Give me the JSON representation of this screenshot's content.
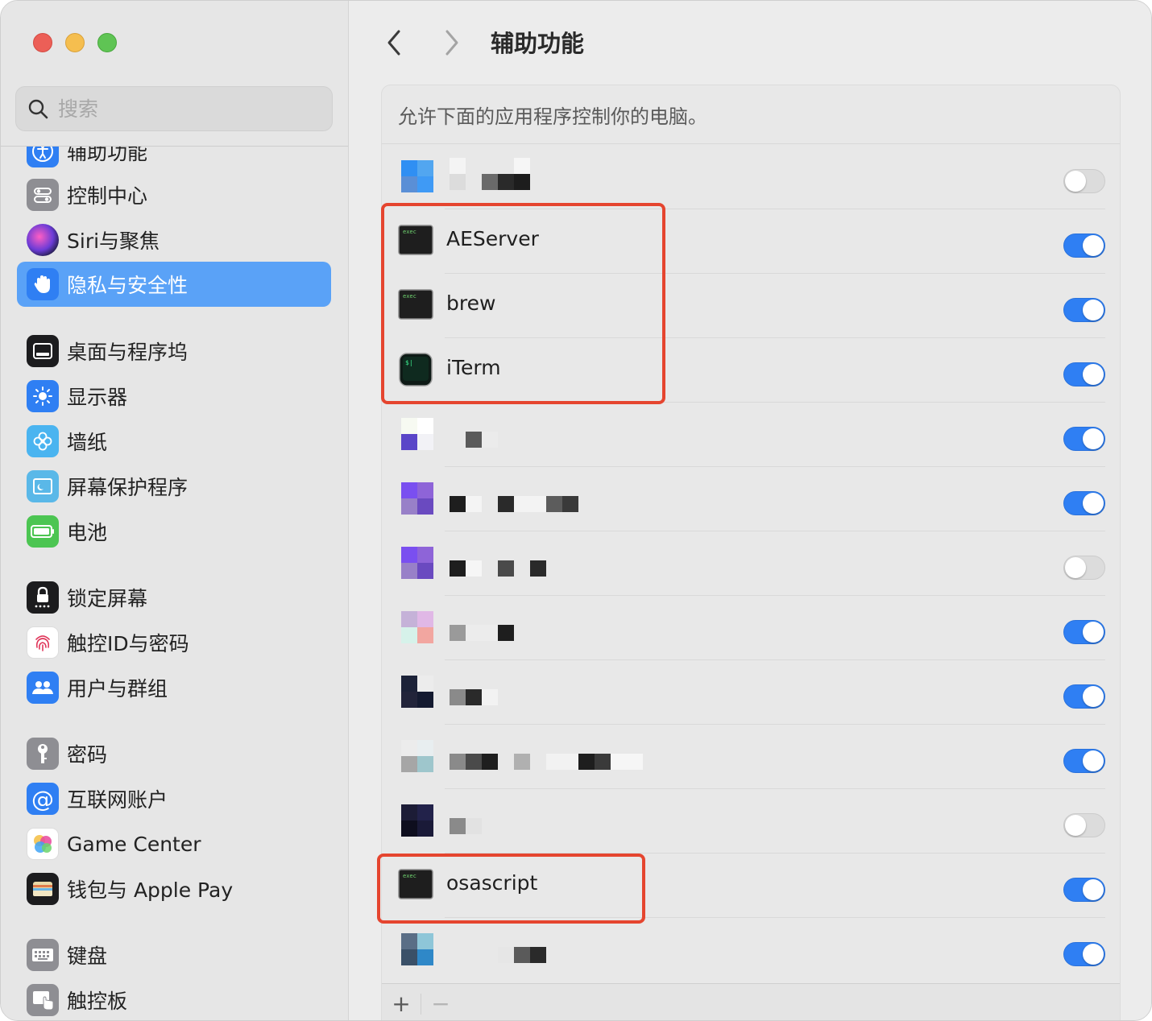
{
  "sidebar": {
    "search_placeholder": "搜索",
    "items": [
      {
        "label": "辅助功能",
        "icon": "accessibility-icon",
        "color": "#2f7ff3"
      },
      {
        "label": "控制中心",
        "icon": "control-center-icon",
        "color": "#8e8e93"
      },
      {
        "label": "Siri与聚焦",
        "icon": "siri-icon",
        "color": "#b146c2"
      },
      {
        "label": "隐私与安全性",
        "icon": "hand-icon",
        "color": "#2f7ff3"
      },
      {
        "label": "桌面与程序坞",
        "icon": "dock-icon",
        "color": "#1c1c1e"
      },
      {
        "label": "显示器",
        "icon": "display-sun-icon",
        "color": "#2f7ff3"
      },
      {
        "label": "墙纸",
        "icon": "wallpaper-flower-icon",
        "color": "#4ab4f0"
      },
      {
        "label": "屏幕保护程序",
        "icon": "screensaver-icon",
        "color": "#5ab8e8"
      },
      {
        "label": "电池",
        "icon": "battery-icon",
        "color": "#4cc552"
      },
      {
        "label": "锁定屏幕",
        "icon": "lock-icon",
        "color": "#1c1c1e"
      },
      {
        "label": "触控ID与密码",
        "icon": "fingerprint-icon",
        "color": "#ffffff"
      },
      {
        "label": "用户与群组",
        "icon": "users-icon",
        "color": "#2f7ff3"
      },
      {
        "label": "密码",
        "icon": "key-icon",
        "color": "#8e8e93"
      },
      {
        "label": "互联网账户",
        "icon": "at-icon",
        "color": "#2f7ff3"
      },
      {
        "label": "Game Center",
        "icon": "game-center-icon",
        "color": "#ffffff"
      },
      {
        "label": "钱包与 Apple Pay",
        "icon": "wallet-icon",
        "color": "#1c1c1e"
      },
      {
        "label": "键盘",
        "icon": "keyboard-icon",
        "color": "#8e8e93"
      },
      {
        "label": "触控板",
        "icon": "trackpad-icon",
        "color": "#8e8e93"
      }
    ],
    "selected_label": "隐私与安全性"
  },
  "main": {
    "title": "辅助功能",
    "description": "允许下面的应用程序控制你的电脑。",
    "apps": [
      {
        "name": "",
        "enabled": false,
        "redacted": true
      },
      {
        "name": "AEServer",
        "enabled": true,
        "icon": "exec-terminal-icon"
      },
      {
        "name": "brew",
        "enabled": true,
        "icon": "exec-terminal-icon"
      },
      {
        "name": "iTerm",
        "enabled": true,
        "icon": "iterm-icon"
      },
      {
        "name": "",
        "enabled": true,
        "redacted": true
      },
      {
        "name": "",
        "enabled": true,
        "redacted": true
      },
      {
        "name": "",
        "enabled": false,
        "redacted": true
      },
      {
        "name": "",
        "enabled": true,
        "redacted": true
      },
      {
        "name": "",
        "enabled": true,
        "redacted": true
      },
      {
        "name": "",
        "enabled": true,
        "redacted": true
      },
      {
        "name": "",
        "enabled": false,
        "redacted": true
      },
      {
        "name": "osascript",
        "enabled": true,
        "icon": "exec-terminal-icon"
      },
      {
        "name": "",
        "enabled": true,
        "redacted": true
      }
    ],
    "add_label": "+",
    "remove_label": "−",
    "exec_badge": "exec",
    "iterm_badge": "$|"
  },
  "colors": {
    "accent": "#2f7ff3",
    "selection": "#5aa2f7",
    "highlight": "#e5452f"
  }
}
